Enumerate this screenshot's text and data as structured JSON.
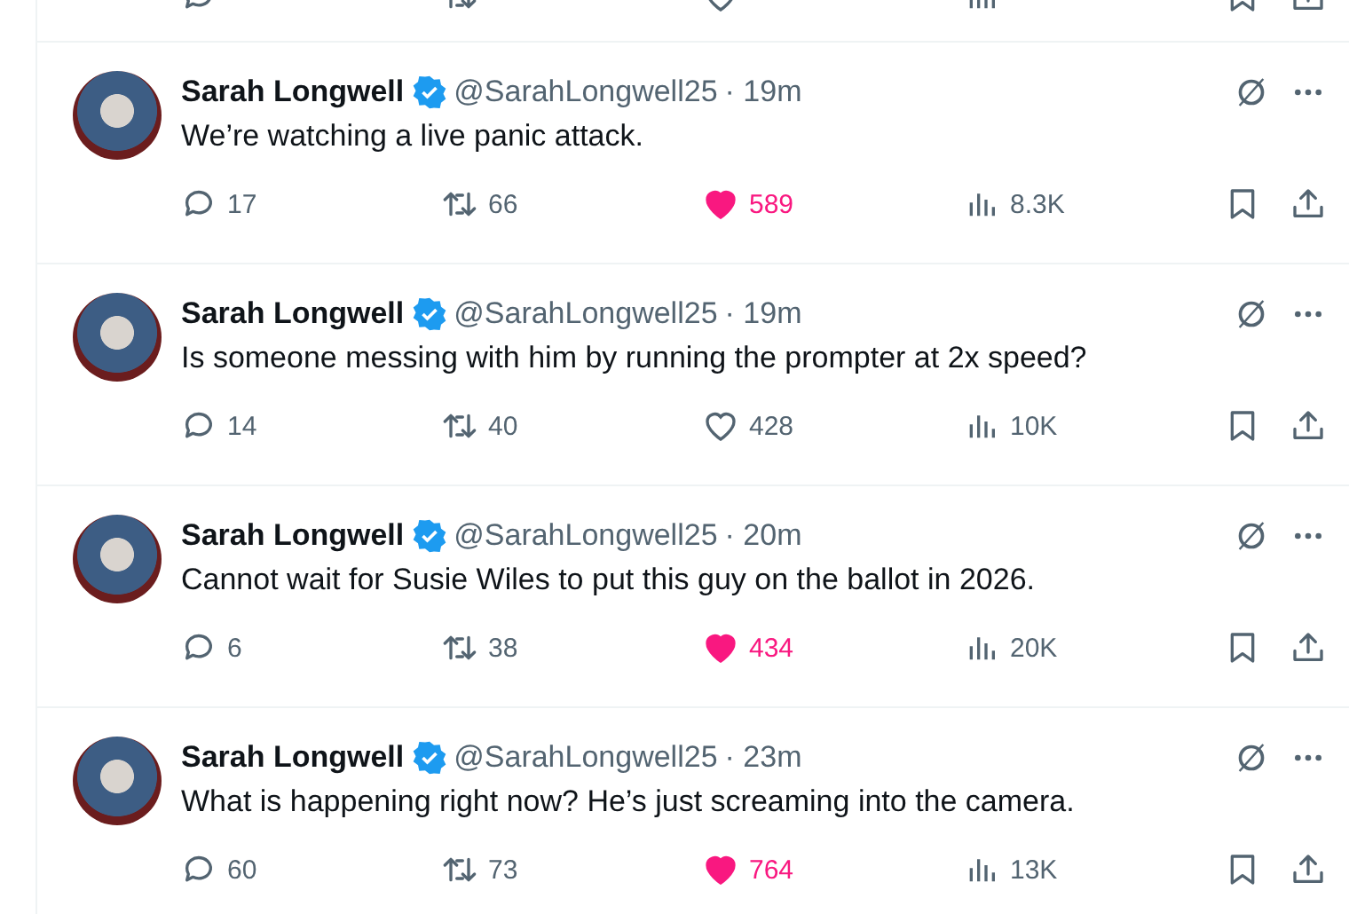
{
  "tweets": [
    {
      "name": "Sarah Longwell",
      "verified": true,
      "handle": "@SarahLongwell25",
      "time": "· 19m",
      "text": "We’re watching a live panic attack.",
      "replies": "17",
      "reposts": "66",
      "likes": "589",
      "liked": true,
      "views": "8.3K"
    },
    {
      "name": "Sarah Longwell",
      "verified": true,
      "handle": "@SarahLongwell25",
      "time": "· 19m",
      "text": "Is someone messing with him by running the prompter at 2x speed?",
      "replies": "14",
      "reposts": "40",
      "likes": "428",
      "liked": false,
      "views": "10K"
    },
    {
      "name": "Sarah Longwell",
      "verified": true,
      "handle": "@SarahLongwell25",
      "time": "· 20m",
      "text": "Cannot wait for Susie Wiles to put this guy on the ballot in 2026.",
      "replies": "6",
      "reposts": "38",
      "likes": "434",
      "liked": true,
      "views": "20K"
    },
    {
      "name": "Sarah Longwell",
      "verified": true,
      "handle": "@SarahLongwell25",
      "time": "· 23m",
      "text": "What is happening right now? He’s just screaming into the camera.",
      "replies": "60",
      "reposts": "73",
      "likes": "764",
      "liked": true,
      "views": "13K"
    }
  ]
}
